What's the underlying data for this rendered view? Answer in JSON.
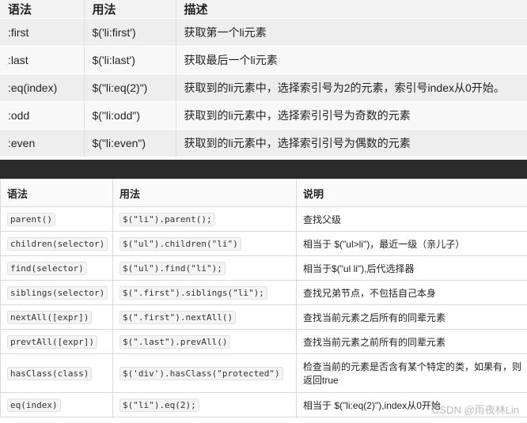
{
  "top_table": {
    "headers": [
      "语法",
      "用法",
      "描述"
    ],
    "rows": [
      [
        ":first",
        "$('li:first')",
        "获取第一个li元素"
      ],
      [
        ":last",
        "$('li:last')",
        "获取最后一个li元素"
      ],
      [
        ":eq(index)",
        "$(\"li:eq(2)\")",
        "获取到的li元素中，选择索引号为2的元素，索引号index从0开始。"
      ],
      [
        ":odd",
        "$(\"li:odd\")",
        "获取到的li元素中，选择索引引号为奇数的元素"
      ],
      [
        ":even",
        "$(\"li:even\")",
        "获取到的li元素中，选择索引引号为偶数的元素"
      ]
    ]
  },
  "bottom_table": {
    "headers": [
      "语法",
      "用法",
      "说明"
    ],
    "rows": [
      [
        "parent()",
        "$(\"li\").parent();",
        "查找父级"
      ],
      [
        "children(selector)",
        "$(\"ul\").children(\"li\")",
        "相当于 $(\"ul>li\")，最近一级（亲儿子）"
      ],
      [
        "find(selector)",
        "$(\"ul\").find(\"li\");",
        "相当于$(\"ul li\"),后代选择器"
      ],
      [
        "siblings(selector)",
        "$(\".first\").siblings(\"li\");",
        "查找兄弟节点，不包括自己本身"
      ],
      [
        "nextAll([expr])",
        "$(\".first\").nextAll()",
        "查找当前元素之后所有的同辈元素"
      ],
      [
        "prevtAll([expr])",
        "$(\".last\").prevAll()",
        "查找当前元素之前所有的同辈元素"
      ],
      [
        "hasClass(class)",
        "$('div').hasClass(\"protected\")",
        "检查当前的元素是否含有某个特定的类，如果有，则返回true"
      ],
      [
        "eq(index)",
        "$(\"li\").eq(2);",
        "相当于 $(\"li:eq(2)\"),index从0开始"
      ]
    ]
  },
  "watermark": "CSDN @雨夜林Lin"
}
